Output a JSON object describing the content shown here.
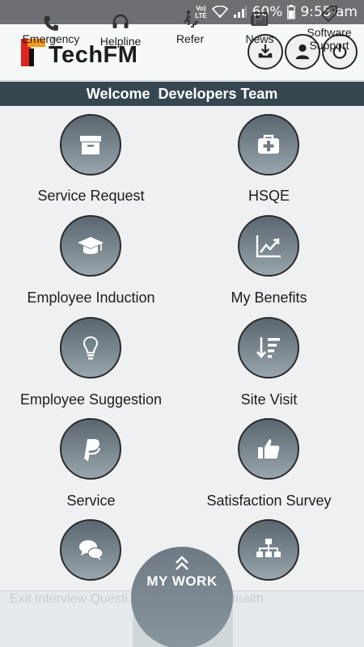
{
  "status_bar": {
    "network": "VoLTE",
    "battery": "60%",
    "time": "9:55 am"
  },
  "header": {
    "logo_small": "N I",
    "logo_text": "TechFM"
  },
  "welcome": "Welcome  Developers Team",
  "tiles": [
    {
      "label": "Service Request",
      "icon": "archive-box-icon"
    },
    {
      "label": "HSQE",
      "icon": "medical-kit-icon"
    },
    {
      "label": "Employee Induction",
      "icon": "graduation-cap-icon"
    },
    {
      "label": "My Benefits",
      "icon": "line-chart-icon"
    },
    {
      "label": "Employee Suggestion",
      "icon": "lightbulb-icon"
    },
    {
      "label": "Site Visit",
      "icon": "sort-descending-icon"
    },
    {
      "label": "Service",
      "icon": "paypal-icon"
    },
    {
      "label": "Satisfaction Survey",
      "icon": "thumbs-up-icon"
    },
    {
      "label": "",
      "icon": "chat-bubbles-icon"
    },
    {
      "label": "",
      "icon": "org-chart-icon"
    }
  ],
  "ticker": "Exit Interview Questi... Responsibility-Health",
  "my_work": {
    "label": "MY WORK"
  },
  "bottom_nav": [
    {
      "label": "Emergency",
      "icon": "phone-icon"
    },
    {
      "label": "Helpline",
      "icon": "headset-icon"
    },
    {
      "label": "Refer",
      "icon": "stairs-person-icon"
    },
    {
      "label": "News",
      "icon": "newspaper-icon"
    },
    {
      "label": "Software Support",
      "icon": "tag-icon"
    }
  ],
  "colors": {
    "status_bar": "#6d6f72",
    "welcome_bar": "#37474f",
    "tile_circle": "#7b8890",
    "background": "#eef0f1",
    "logo_red": "#e0231f",
    "logo_orange": "#f59a1c"
  }
}
